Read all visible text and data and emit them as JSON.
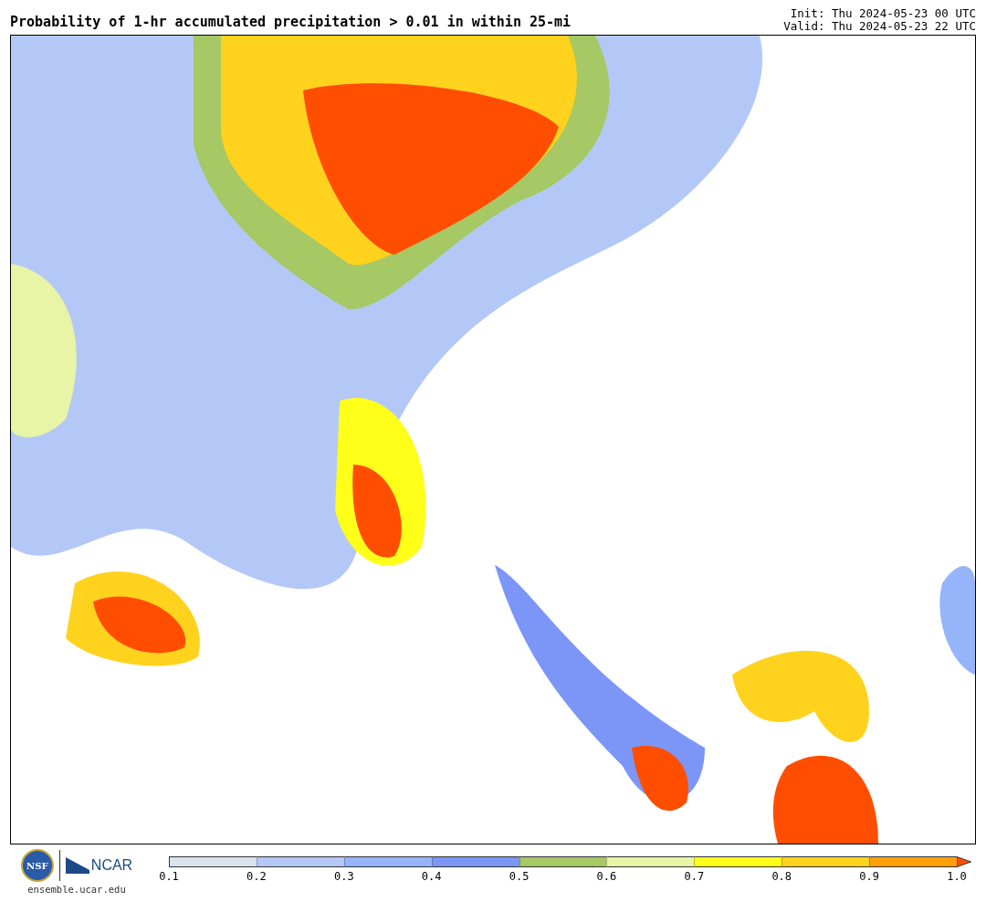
{
  "title": "Probability of 1-hr accumulated precipitation > 0.01 in within 25-mi",
  "run_info": [
    "Init: Thu 2024-05-23 00 UTC",
    "Valid: Thu 2024-05-23 22 UTC"
  ],
  "logos": {
    "nsf": "NSF",
    "ncar": "NCAR",
    "url": "ensemble.ucar.edu"
  },
  "colorbar": {
    "bins": [
      {
        "color": "#d9e3ee"
      },
      {
        "color": "#b4c8f8"
      },
      {
        "color": "#96b4fa"
      },
      {
        "color": "#7b96f6"
      },
      {
        "color": "#a6c865"
      },
      {
        "color": "#e8f4a6"
      },
      {
        "color": "#ffff1a"
      },
      {
        "color": "#ffd21e"
      },
      {
        "color": "#ffa00a"
      }
    ],
    "over": {
      "color": "#ff4e00"
    },
    "ticks": [
      "0.1",
      "0.2",
      "0.3",
      "0.4",
      "0.5",
      "0.6",
      "0.7",
      "0.8",
      "0.9",
      "1.0"
    ]
  }
}
